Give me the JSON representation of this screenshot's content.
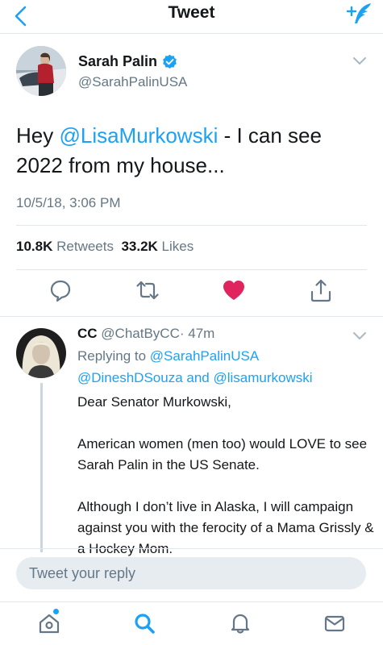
{
  "header": {
    "title": "Tweet"
  },
  "tweet": {
    "author_name": "Sarah Palin",
    "author_handle": "@SarahPalinUSA",
    "text_prefix": "Hey ",
    "mention": "@LisaMurkowski",
    "text_suffix": " - I can see 2022 from my house...",
    "timestamp": "10/5/18, 3:06 PM",
    "retweets_count": "10.8K",
    "retweets_label": "Retweets",
    "likes_count": "33.2K",
    "likes_label": "Likes",
    "liked": true
  },
  "reply": {
    "author_name": "CC",
    "author_handle": "@ChatByCC",
    "separator": "·",
    "age": "47m",
    "replying_prefix": "Replying to",
    "reply_to_1": "@SarahPalinUSA",
    "reply_to_2": "@DineshDSouza",
    "and_text": "and",
    "reply_to_3": "@lisamurkowski",
    "body": [
      "Dear Senator Murkowski,",
      "American women (men too) would LOVE to see Sarah Palin in the US Senate.",
      "Although I don’t live in Alaska, I will campaign against you with the ferocity of a Mama Grissly & a Hockey Mom."
    ]
  },
  "composer": {
    "placeholder": "Tweet your reply"
  },
  "tabs": [
    "home-icon",
    "search-icon",
    "notifications-icon",
    "messages-icon"
  ],
  "colors": {
    "accent": "#1da1f2",
    "like": "#e0245e",
    "muted": "#657786"
  }
}
